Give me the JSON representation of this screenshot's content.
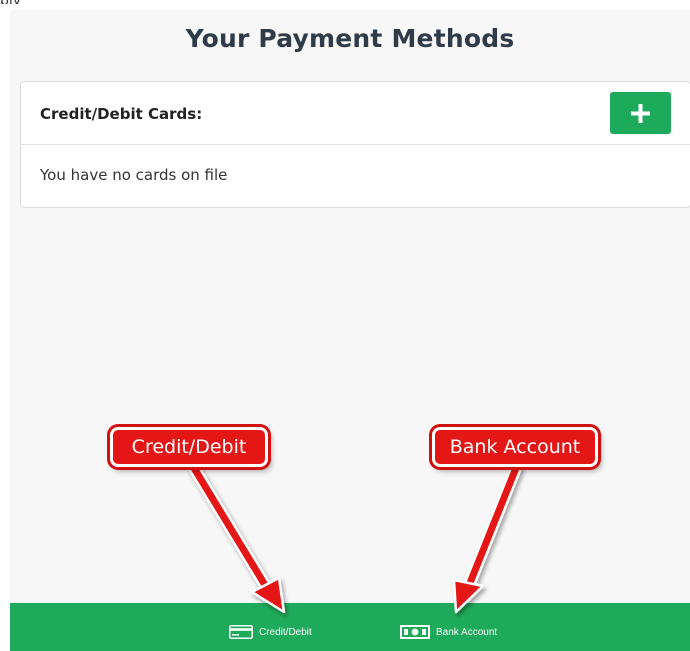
{
  "top_crop_text": "ply",
  "header": {
    "title": "Your Payment Methods"
  },
  "cards_panel": {
    "title": "Credit/Debit Cards:",
    "add_label": "+",
    "empty_message": "You have no cards on file"
  },
  "bottom_nav": {
    "items": [
      {
        "label": "Credit/Debit",
        "icon": "credit-card-icon"
      },
      {
        "label": "Bank Account",
        "icon": "bank-money-icon"
      }
    ]
  },
  "annotations": {
    "credit_callout": "Credit/Debit",
    "bank_callout": "Bank Account"
  },
  "colors": {
    "accent_green": "#1eaa5b",
    "title_text": "#2f3b48",
    "callout_red": "#e51616",
    "page_background": "#f7f7f7"
  }
}
